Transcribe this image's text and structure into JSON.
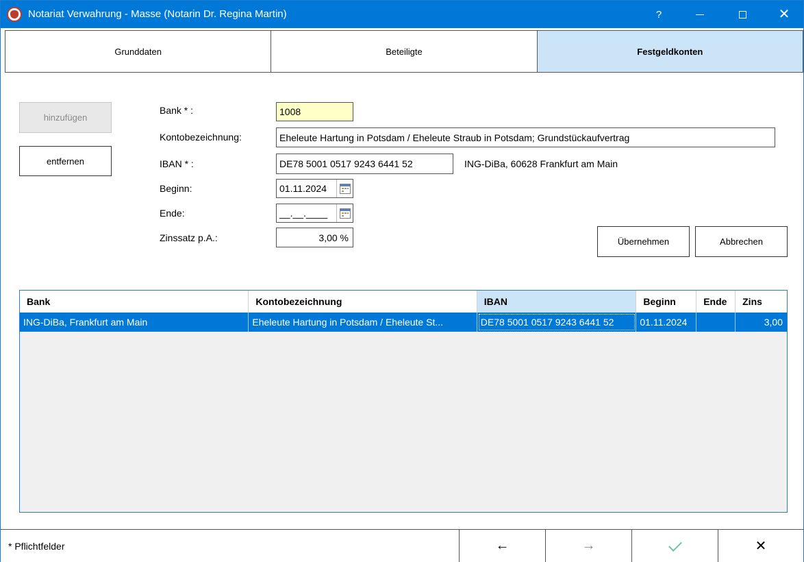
{
  "window": {
    "title": "Notariat Verwahrung - Masse (Notarin Dr. Regina Martin)",
    "help_label": "?",
    "accent": "#0078d7"
  },
  "tabs": [
    {
      "label": "Grunddaten",
      "active": false
    },
    {
      "label": "Beteiligte",
      "active": false
    },
    {
      "label": "Festgeldkonten",
      "active": true
    }
  ],
  "actions": {
    "add_label": "hinzufügen",
    "remove_label": "entfernen",
    "apply_label": "Übernehmen",
    "cancel_label": "Abbrechen"
  },
  "form": {
    "bank": {
      "label": "Bank * :",
      "value": "1008"
    },
    "kontobezeichnung": {
      "label": "Kontobezeichnung:",
      "value": "Eheleute Hartung in Potsdam / Eheleute Straub in Potsdam; Grundstückaufvertrag"
    },
    "iban": {
      "label": "IBAN * :",
      "value": "DE78 5001 0517 9243 6441 52",
      "bank_hint": "ING-DiBa, 60628 Frankfurt am Main"
    },
    "beginn": {
      "label": "Beginn:",
      "value": "01.11.2024"
    },
    "ende": {
      "label": "Ende:",
      "value": "__.__.____"
    },
    "zinssatz": {
      "label": "Zinssatz p.A.:",
      "value": "3,00 %"
    }
  },
  "grid": {
    "columns": [
      "Bank",
      "Kontobezeichnung",
      "IBAN",
      "Beginn",
      "Ende",
      "Zins"
    ],
    "sorted_column": "IBAN",
    "rows": [
      {
        "bank": "ING-DiBa, Frankfurt am Main",
        "kontobezeichnung": "Eheleute Hartung in Potsdam / Eheleute St...",
        "iban": "DE78 5001 0517 9243 6441 52",
        "beginn": "01.11.2024",
        "ende": "",
        "zins": "3,00"
      }
    ]
  },
  "footer": {
    "hint": "* Pflichtfelder",
    "back_label": "←",
    "forward_label": "→",
    "close_label": "✕"
  }
}
